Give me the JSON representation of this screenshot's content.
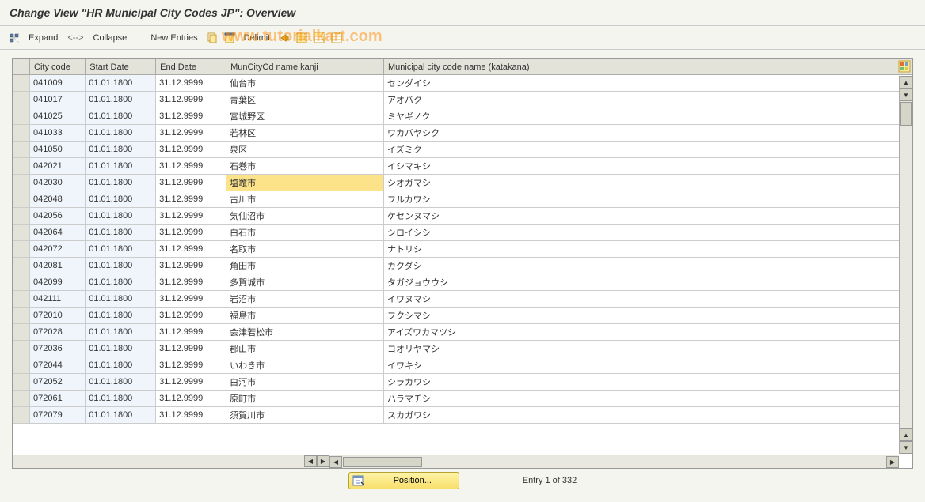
{
  "title": "Change View \"HR Municipal City Codes JP\": Overview",
  "toolbar": {
    "expand": "Expand",
    "collapse": "Collapse",
    "sep": "<-->",
    "new_entries": "New Entries",
    "delimit": "Delimit"
  },
  "watermark": "www.tutorialkart.com",
  "columns": {
    "citycode": "City code",
    "startdate": "Start Date",
    "enddate": "End Date",
    "kanji": "MunCityCd name kanji",
    "katakana": "Municipal city code name (katakana)"
  },
  "rows": [
    {
      "code": "041009",
      "start": "01.01.1800",
      "end": "31.12.9999",
      "kanji": "仙台市",
      "kata": "センダイシ",
      "hl": false
    },
    {
      "code": "041017",
      "start": "01.01.1800",
      "end": "31.12.9999",
      "kanji": "青葉区",
      "kata": "アオバク",
      "hl": false
    },
    {
      "code": "041025",
      "start": "01.01.1800",
      "end": "31.12.9999",
      "kanji": "宮城野区",
      "kata": "ミヤギノク",
      "hl": false
    },
    {
      "code": "041033",
      "start": "01.01.1800",
      "end": "31.12.9999",
      "kanji": "若林区",
      "kata": "ワカバヤシク",
      "hl": false
    },
    {
      "code": "041050",
      "start": "01.01.1800",
      "end": "31.12.9999",
      "kanji": "泉区",
      "kata": "イズミク",
      "hl": false
    },
    {
      "code": "042021",
      "start": "01.01.1800",
      "end": "31.12.9999",
      "kanji": "石巻市",
      "kata": "イシマキシ",
      "hl": false
    },
    {
      "code": "042030",
      "start": "01.01.1800",
      "end": "31.12.9999",
      "kanji": "塩竈市",
      "kata": "シオガマシ",
      "hl": true
    },
    {
      "code": "042048",
      "start": "01.01.1800",
      "end": "31.12.9999",
      "kanji": "古川市",
      "kata": "フルカワシ",
      "hl": false
    },
    {
      "code": "042056",
      "start": "01.01.1800",
      "end": "31.12.9999",
      "kanji": "気仙沼市",
      "kata": "ケセンヌマシ",
      "hl": false
    },
    {
      "code": "042064",
      "start": "01.01.1800",
      "end": "31.12.9999",
      "kanji": "白石市",
      "kata": "シロイシシ",
      "hl": false
    },
    {
      "code": "042072",
      "start": "01.01.1800",
      "end": "31.12.9999",
      "kanji": "名取市",
      "kata": "ナトリシ",
      "hl": false
    },
    {
      "code": "042081",
      "start": "01.01.1800",
      "end": "31.12.9999",
      "kanji": "角田市",
      "kata": "カクダシ",
      "hl": false
    },
    {
      "code": "042099",
      "start": "01.01.1800",
      "end": "31.12.9999",
      "kanji": "多賀城市",
      "kata": "タガジョウウシ",
      "hl": false
    },
    {
      "code": "042111",
      "start": "01.01.1800",
      "end": "31.12.9999",
      "kanji": "岩沼市",
      "kata": "イワヌマシ",
      "hl": false
    },
    {
      "code": "072010",
      "start": "01.01.1800",
      "end": "31.12.9999",
      "kanji": "福島市",
      "kata": "フクシマシ",
      "hl": false
    },
    {
      "code": "072028",
      "start": "01.01.1800",
      "end": "31.12.9999",
      "kanji": "会津若松市",
      "kata": "アイズワカマツシ",
      "hl": false
    },
    {
      "code": "072036",
      "start": "01.01.1800",
      "end": "31.12.9999",
      "kanji": "郡山市",
      "kata": "コオリヤマシ",
      "hl": false
    },
    {
      "code": "072044",
      "start": "01.01.1800",
      "end": "31.12.9999",
      "kanji": "いわき市",
      "kata": "イワキシ",
      "hl": false
    },
    {
      "code": "072052",
      "start": "01.01.1800",
      "end": "31.12.9999",
      "kanji": "白河市",
      "kata": "シラカワシ",
      "hl": false
    },
    {
      "code": "072061",
      "start": "01.01.1800",
      "end": "31.12.9999",
      "kanji": "原町市",
      "kata": "ハラマチシ",
      "hl": false
    },
    {
      "code": "072079",
      "start": "01.01.1800",
      "end": "31.12.9999",
      "kanji": "須賀川市",
      "kata": "スカガワシ",
      "hl": false
    }
  ],
  "footer": {
    "position_label": "Position...",
    "entry_text": "Entry 1 of 332"
  }
}
